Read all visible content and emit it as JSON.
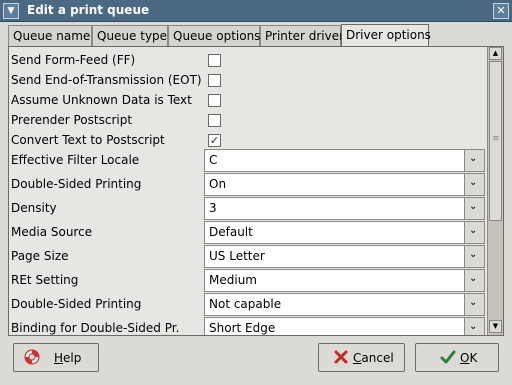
{
  "window": {
    "title": "Edit a print queue",
    "close_glyph": "✕",
    "menu_glyph": "▼",
    "icons": {
      "menu": "window-menu-icon",
      "close": "close-icon"
    },
    "colors": {
      "titlebar": "#4b6983",
      "background": "#dcdad5"
    }
  },
  "tabs": [
    {
      "label": "Queue name",
      "active": false
    },
    {
      "label": "Queue type",
      "active": false
    },
    {
      "label": "Queue options",
      "active": false
    },
    {
      "label": "Printer driver",
      "active": false
    },
    {
      "label": "Driver options",
      "active": true
    }
  ],
  "options": {
    "checkboxes": [
      {
        "label": "Send Form-Feed (FF)",
        "checked": false,
        "mark": ""
      },
      {
        "label": "Send End-of-Transmission (EOT)",
        "checked": false,
        "mark": ""
      },
      {
        "label": "Assume Unknown Data is Text",
        "checked": false,
        "mark": ""
      },
      {
        "label": "Prerender Postscript",
        "checked": false,
        "mark": ""
      },
      {
        "label": "Convert Text to Postscript",
        "checked": true,
        "mark": "✓"
      }
    ],
    "dropdowns": [
      {
        "label": "Effective Filter Locale",
        "value": "C"
      },
      {
        "label": "Double-Sided Printing",
        "value": "On"
      },
      {
        "label": "Density",
        "value": "3"
      },
      {
        "label": "Media Source",
        "value": "Default"
      },
      {
        "label": "Page Size",
        "value": "US Letter"
      },
      {
        "label": "REt Setting",
        "value": "Medium"
      },
      {
        "label": "Double-Sided Printing",
        "value": "Not capable"
      },
      {
        "label": "Binding for Double-Sided Pr.",
        "value": "Short Edge"
      }
    ],
    "dropdown_arrow_glyph": "⌄"
  },
  "scrollbar": {
    "up_glyph": "▲",
    "down_glyph": "▼",
    "grip_glyph": "≡"
  },
  "buttons": {
    "help": {
      "label": "Help",
      "mnemonic": "H",
      "icon": "help-lifebuoy-icon"
    },
    "cancel": {
      "label": "Cancel",
      "mnemonic": "C",
      "icon": "red-x-icon"
    },
    "ok": {
      "label": "OK",
      "mnemonic": "O",
      "icon": "green-check-icon"
    }
  }
}
